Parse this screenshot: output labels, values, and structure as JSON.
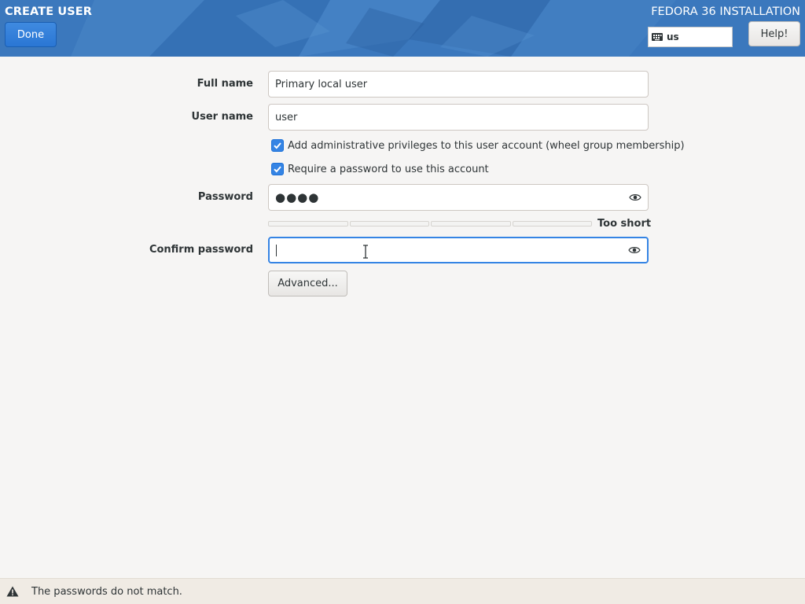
{
  "header": {
    "title": "CREATE USER",
    "product": "FEDORA 36 INSTALLATION",
    "done_label": "Done",
    "help_label": "Help!",
    "keyboard_layout": "us",
    "keyboard_icon": "keyboard-icon",
    "accent_color": "#3b78bd"
  },
  "form": {
    "full_name": {
      "label": "Full name",
      "value": "Primary local user"
    },
    "user_name": {
      "label": "User name",
      "value": "user"
    },
    "admin_checkbox": {
      "label": "Add administrative privileges to this user account (wheel group membership)",
      "checked": true
    },
    "require_password_checkbox": {
      "label": "Require a password to use this account",
      "checked": true
    },
    "password": {
      "label": "Password",
      "value": "●●●●",
      "reveal_icon": "eye-icon"
    },
    "strength": {
      "label": "Too short",
      "level": 0
    },
    "confirm_password": {
      "label": "Confirm password",
      "value": "",
      "reveal_icon": "eye-icon"
    },
    "advanced_label": "Advanced..."
  },
  "status": {
    "icon": "warning-icon",
    "message": "The passwords do not match."
  }
}
